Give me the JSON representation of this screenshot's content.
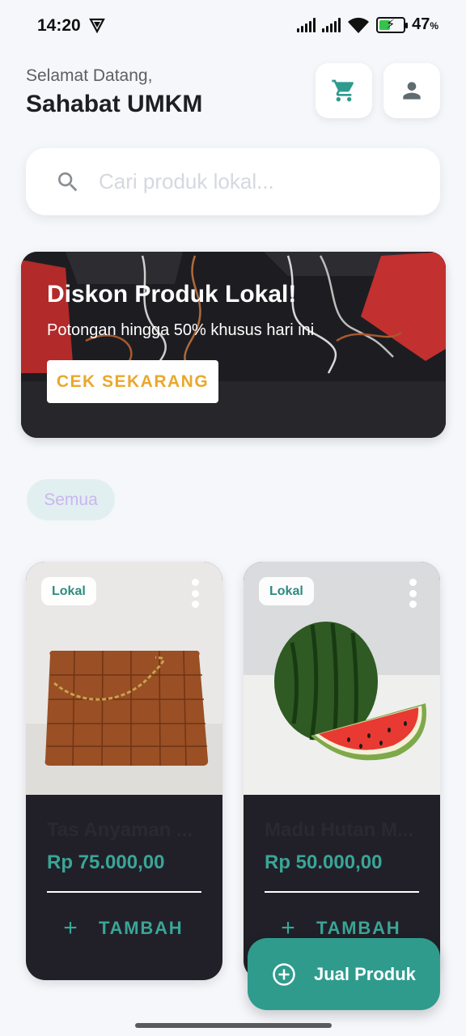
{
  "status_bar": {
    "time": "14:20",
    "battery_percent": "47",
    "battery_unit": "%",
    "battery_level": 0.47,
    "battery_charging": true,
    "icons": [
      "vpn-icon",
      "signal-icon",
      "signal-icon",
      "wifi-icon",
      "battery-icon"
    ]
  },
  "header": {
    "greeting": "Selamat Datang,",
    "user_name": "Sahabat UMKM",
    "cart_icon": "cart-icon",
    "profile_icon": "person-icon"
  },
  "search": {
    "placeholder": "Cari produk lokal...",
    "value": "",
    "icon": "search-icon"
  },
  "banner": {
    "title": "Diskon Produk Lokal!",
    "subtitle": "Potongan hingga 50% khusus hari ini",
    "cta_label": "CEK SEKARANG"
  },
  "categories": [
    {
      "label": "Semua",
      "selected": true
    }
  ],
  "products": [
    {
      "badge": "Lokal",
      "name": "Tas Anyaman ...",
      "price": "Rp 75.000,00",
      "add_label": "TAMBAH",
      "add_icon": "+"
    },
    {
      "badge": "Lokal",
      "name": "Madu Hutan M...",
      "price": "Rp 50.000,00",
      "add_label": "TAMBAH",
      "add_icon": "+"
    }
  ],
  "fab": {
    "label": "Jual Produk",
    "icon": "add-circle-icon"
  },
  "colors": {
    "accent": "#2f9b8d",
    "accent_text": "#3aa597",
    "cta_text": "#e9a82c",
    "card_bg": "#212028",
    "page_bg": "#f5f7fb"
  }
}
